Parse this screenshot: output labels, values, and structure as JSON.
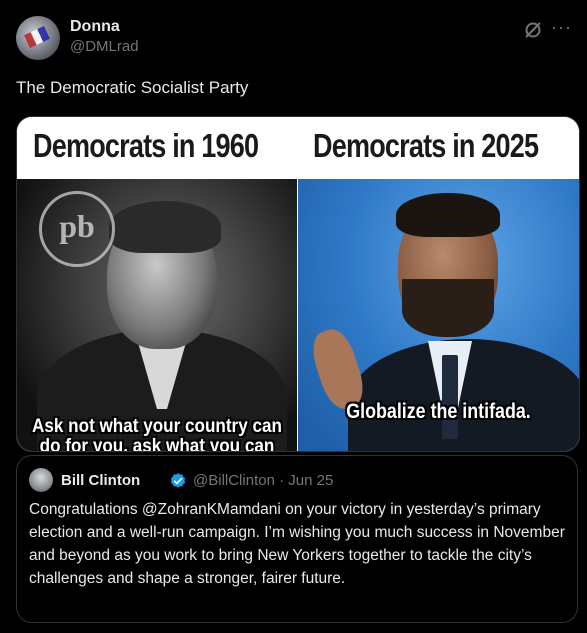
{
  "post": {
    "author_name": "Donna",
    "author_handle": "@DMLrad",
    "text": "The Democratic Socialist Party",
    "icons": {
      "grok": "grok-icon",
      "more": "more-icon",
      "avatar": "avatar"
    }
  },
  "media": {
    "banner_left": "Democrats in 1960",
    "banner_right": "Democrats in 2025",
    "logo_text": "pb",
    "caption_left": "Ask not what your country can do for you, ask what you can do for your country.",
    "caption_right": "Globalize the intifada."
  },
  "quote": {
    "author_name": "Bill Clinton",
    "author_handle_date": "@BillClinton · Jun 25",
    "verified_color": "#1d9bf0",
    "text": "Congratulations @ZohranKMamdani on your victory in yesterday’s primary election and a well-run campaign. I’m wishing you much success in November and beyond as you work to bring New Yorkers together to tackle the city’s challenges and shape a stronger, fairer future."
  },
  "colors": {
    "background": "#000000",
    "text": "#e7e9ea",
    "muted": "#71767b",
    "border": "#2f3336",
    "verified": "#1d9bf0"
  }
}
